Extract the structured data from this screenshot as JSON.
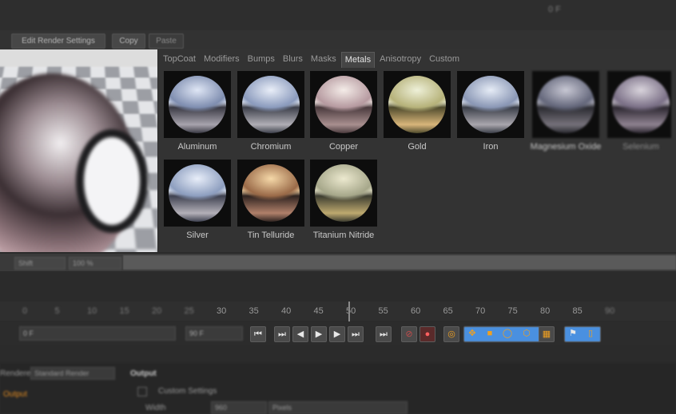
{
  "toolbar": {
    "button1": "Edit Render Settings",
    "copy": "Copy",
    "paste": "Paste"
  },
  "tabs": [
    "TopCoat",
    "Modifiers",
    "Bumps",
    "Blurs",
    "Masks",
    "Metals",
    "Anisotropy",
    "Custom"
  ],
  "active_tab": "Metals",
  "materials": [
    {
      "label": "Aluminum",
      "colors": [
        "#dfe6f5",
        "#7f8eb0",
        "#3a3a44",
        "#a7a3ad"
      ]
    },
    {
      "label": "Chromium",
      "colors": [
        "#e9eef8",
        "#8b9bbd",
        "#3c3f4a",
        "#b0aeb5"
      ]
    },
    {
      "label": "Copper",
      "colors": [
        "#f4ece8",
        "#b69aa0",
        "#4a3a3d",
        "#a88f8f"
      ]
    },
    {
      "label": "Gold",
      "colors": [
        "#eef0d8",
        "#b6b27a",
        "#4e4a2c",
        "#d8b57a"
      ]
    },
    {
      "label": "Iron",
      "colors": [
        "#e6ecf6",
        "#8a97b5",
        "#3a3e48",
        "#a9a6ad"
      ]
    },
    {
      "label": "Magnesium Oxide",
      "colors": [
        "#c8c8d4",
        "#63667a",
        "#2a2a30",
        "#75717a"
      ]
    },
    {
      "label": "Selenium",
      "colors": [
        "#d9d4dc",
        "#7a6f86",
        "#2c2730",
        "#8e8290"
      ]
    },
    {
      "label": "Silver",
      "colors": [
        "#e8eef9",
        "#8d9ebf",
        "#3e4150",
        "#b3b0b8"
      ]
    },
    {
      "label": "Tin Telluride",
      "colors": [
        "#f5d8a8",
        "#9a6a48",
        "#2e2320",
        "#b0806a"
      ]
    },
    {
      "label": "Titanium Nitride",
      "colors": [
        "#ece9cf",
        "#a6a78a",
        "#3c3c30",
        "#bda96f"
      ]
    }
  ],
  "strip": {
    "field1": "Shift",
    "field2": "100 %"
  },
  "ruler": {
    "ticks": [
      "0",
      "5",
      "10",
      "15",
      "20",
      "25",
      "30",
      "35",
      "40",
      "45",
      "50",
      "55",
      "60",
      "65",
      "70",
      "75",
      "80",
      "85",
      "90"
    ],
    "frame_label": "0 F"
  },
  "transport": {
    "start": "0 F",
    "end": "90 F",
    "end2": "90 F"
  },
  "attributes": {
    "section": "Output",
    "custom_settings": "Custom Settings",
    "width_label": "Width",
    "width_value": "960",
    "units": "Pixels",
    "left_item1": "Standard Render",
    "left_item2": "Output",
    "left_label": "Renderer"
  }
}
